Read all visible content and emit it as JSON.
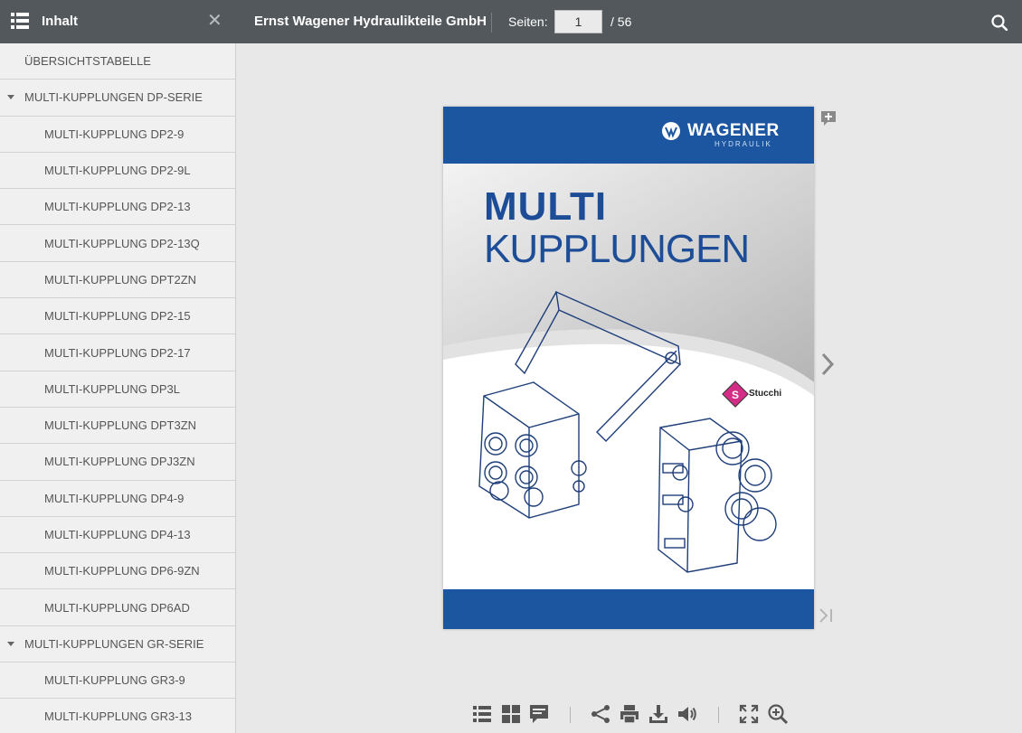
{
  "header": {
    "sidebar_title": "Inhalt",
    "document_title": "Ernst Wagener Hydraulikteile GmbH",
    "pages_label": "Seiten:",
    "current_page": "1",
    "total_pages": "/ 56"
  },
  "sidebar": {
    "items": [
      {
        "label": "ÜBERSICHTSTABELLE",
        "level": 0,
        "expandable": false
      },
      {
        "label": "MULTI-KUPPLUNGEN DP-SERIE",
        "level": 0,
        "expandable": true
      },
      {
        "label": "MULTI-KUPPLUNG DP2-9",
        "level": 1
      },
      {
        "label": "MULTI-KUPPLUNG DP2-9L",
        "level": 1
      },
      {
        "label": "MULTI-KUPPLUNG DP2-13",
        "level": 1
      },
      {
        "label": "MULTI-KUPPLUNG DP2-13Q",
        "level": 1
      },
      {
        "label": "MULTI-KUPPLUNG DPT2ZN",
        "level": 1
      },
      {
        "label": "MULTI-KUPPLUNG DP2-15",
        "level": 1
      },
      {
        "label": "MULTI-KUPPLUNG DP2-17",
        "level": 1
      },
      {
        "label": "MULTI-KUPPLUNG DP3L",
        "level": 1
      },
      {
        "label": "MULTI-KUPPLUNG DPT3ZN",
        "level": 1
      },
      {
        "label": "MULTI-KUPPLUNG DPJ3ZN",
        "level": 1
      },
      {
        "label": "MULTI-KUPPLUNG DP4-9",
        "level": 1
      },
      {
        "label": "MULTI-KUPPLUNG DP4-13",
        "level": 1
      },
      {
        "label": "MULTI-KUPPLUNG DP6-9ZN",
        "level": 1
      },
      {
        "label": "MULTI-KUPPLUNG DP6AD",
        "level": 1
      },
      {
        "label": "MULTI-KUPPLUNGEN GR-SERIE",
        "level": 0,
        "expandable": true
      },
      {
        "label": "MULTI-KUPPLUNG GR3-9",
        "level": 1
      },
      {
        "label": "MULTI-KUPPLUNG GR3-13",
        "level": 1
      }
    ]
  },
  "cover": {
    "title_line1": "MULTI",
    "title_line2": "KUPPLUNGEN",
    "brand": "WAGENER",
    "brand_sub": "HYDRAULIK",
    "partner": "Stucchi"
  },
  "toolbar": {
    "icons": [
      "toc-icon",
      "thumbnails-icon",
      "notes-icon",
      "share-icon",
      "print-icon",
      "download-icon",
      "sound-icon",
      "fullscreen-icon",
      "zoom-in-icon"
    ]
  },
  "colors": {
    "topbar": "#53585c",
    "brand_blue": "#1c56a0",
    "sidebar_bg": "#f0f0f0",
    "viewer_bg": "#e8e8e8"
  }
}
